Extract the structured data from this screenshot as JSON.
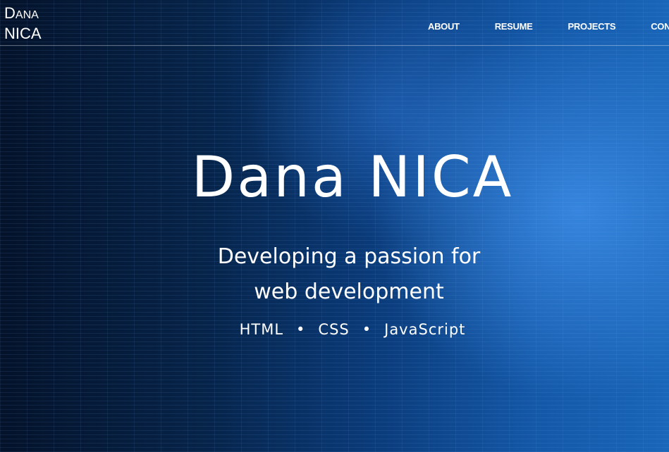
{
  "header": {
    "logo_first": "D",
    "logo_first_rest": "ANA",
    "logo_last": "NICA",
    "nav": [
      "ABOUT",
      "RESUME",
      "PROJECTS",
      "CONTACT"
    ]
  },
  "hero": {
    "title": "Dana NICA",
    "tagline_line1": "Developing a passion for",
    "tagline_line2": "web development",
    "skills": [
      "HTML",
      "CSS",
      "JavaScript"
    ],
    "separator": "•"
  },
  "colors": {
    "background_dark": "#04122a",
    "background_bright": "#1a66b8",
    "text": "#ffffff"
  }
}
